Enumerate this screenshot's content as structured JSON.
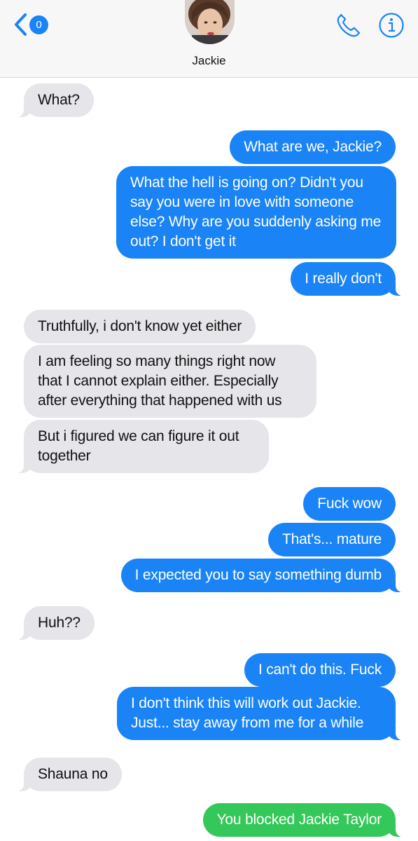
{
  "header": {
    "back_badge": "0",
    "contact_name": "Jackie",
    "accent_color": "#1a84f7"
  },
  "icons": {
    "back": "chevron-left-icon",
    "phone": "phone-icon",
    "info": "info-icon"
  },
  "messages": [
    {
      "from": "them",
      "text": "What?"
    },
    {
      "from": "me",
      "text": "What are we, Jackie?"
    },
    {
      "from": "me",
      "text": "What the hell is going on? Didn't you say you were in love with someone else? Why are you suddenly asking me out? I don't get it"
    },
    {
      "from": "me",
      "text": "I really don't"
    },
    {
      "from": "them",
      "text": "Truthfully, i don't know yet either"
    },
    {
      "from": "them",
      "text": "I am feeling so many things right now that I cannot explain either. Especially after everything that happened with us"
    },
    {
      "from": "them",
      "text": "But i figured we can figure it out together"
    },
    {
      "from": "me",
      "text": "Fuck wow"
    },
    {
      "from": "me",
      "text": "That's... mature"
    },
    {
      "from": "me",
      "text": "I expected you to say something dumb"
    },
    {
      "from": "them",
      "text": "Huh??"
    },
    {
      "from": "me",
      "text": "I can't do this. Fuck"
    },
    {
      "from": "me",
      "text": "I don't think this will work out Jackie. Just... stay away from me for a while"
    },
    {
      "from": "them",
      "text": "Shauna no"
    },
    {
      "from": "me",
      "text": "You blocked Jackie Taylor",
      "style": "green"
    }
  ],
  "colors": {
    "incoming": "#e5e5ea",
    "outgoing": "#1a84f7",
    "system_green": "#34c759"
  }
}
